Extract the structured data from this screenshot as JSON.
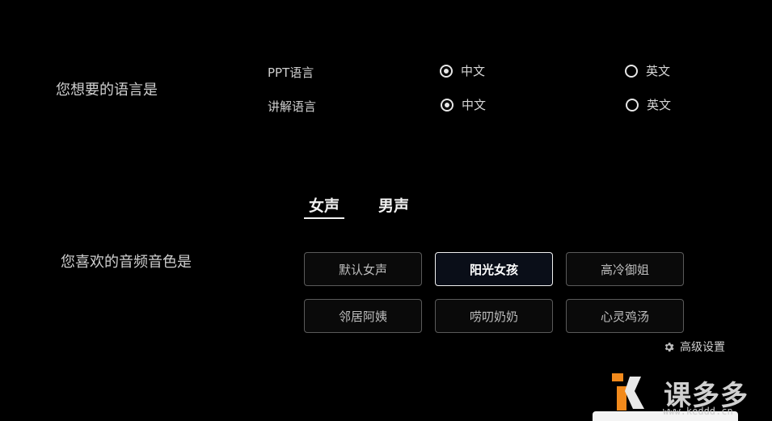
{
  "language": {
    "question": "您想要的语言是",
    "rows": [
      {
        "label": "PPT语言",
        "options": [
          {
            "label": "中文",
            "checked": true
          },
          {
            "label": "英文",
            "checked": false
          }
        ]
      },
      {
        "label": "讲解语言",
        "options": [
          {
            "label": "中文",
            "checked": true
          },
          {
            "label": "英文",
            "checked": false
          }
        ]
      }
    ]
  },
  "voice": {
    "question": "您喜欢的音频音色是",
    "tabs": [
      {
        "label": "女声",
        "active": true
      },
      {
        "label": "男声",
        "active": false
      }
    ],
    "options": [
      "默认女声",
      "阳光女孩",
      "高冷御姐",
      "邻居阿姨",
      "唠叨奶奶",
      "心灵鸡汤"
    ],
    "selected_index": 1,
    "advanced_label": "高级设置"
  },
  "watermark": {
    "logo_text": "课多多",
    "url": "www.keddd.cn"
  },
  "colors": {
    "background": "#000000",
    "accent_logo": "#f28a1c",
    "text": "#d8d8d8"
  }
}
